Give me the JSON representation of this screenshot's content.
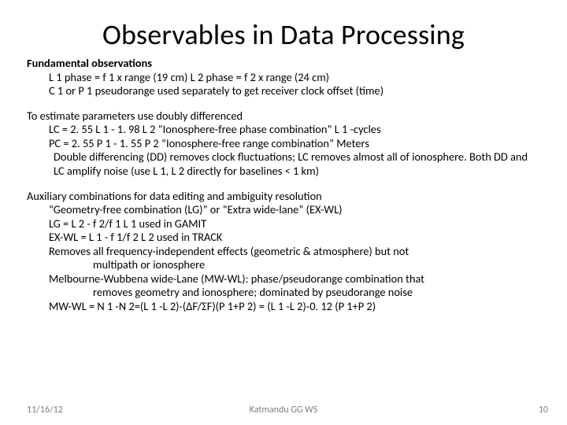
{
  "title": "Observables in Data Processing",
  "sections": {
    "fundamental": {
      "head": "Fundamental observations",
      "l1": "L 1 phase = f 1 x range    (19 cm)     L 2 phase = f 2 x range  (24 cm)",
      "l2": "C 1 or P 1 pseudorange used separately to get receiver clock offset (time)"
    },
    "estimate": {
      "head": "To estimate parameters use doubly differenced",
      "l1": "LC = 2. 55 L 1 - 1. 98 L 2     “Ionosphere-free phase combination”  L 1 -cycles",
      "l2": "PC = 2. 55 P 1 - 1. 55 P 2     “Ionosphere-free range combination”   Meters",
      "l3": " Double differencing (DD) removes clock fluctuations; LC removes almost all of ionosphere.  Both DD and LC amplify noise (use L 1, L 2 directly for baselines < 1 km)"
    },
    "aux": {
      "head": "Auxiliary combinations for data editing and ambiguity resolution",
      "l1": "“Geometry-free combination (LG)”  or “Extra wide-lane” (EX-WL)",
      "l2": "LG = L 2  - f 2/f 1 L 1    used in GAMIT",
      "l3": "EX-WL = L 1 - f 1/f 2 L 2   used in TRACK",
      "l4": "Removes all frequency-independent effects (geometric & atmosphere) but not multipath or ionosphere",
      "l5": "Melbourne-Wubbena wide-Lane (MW-WL):  phase/pseudorange combination that removes geometry and ionosphere; dominated by pseudorange noise",
      "l6": "MW-WL = N 1 -N 2=(L 1 -L 2)-(ΔF/ΣF)(P 1+P 2) = (L 1 -L 2)-0. 12 (P 1+P 2)"
    }
  },
  "footer": {
    "date": "11/16/12",
    "center": "Katmandu GG WS",
    "page": "10"
  }
}
